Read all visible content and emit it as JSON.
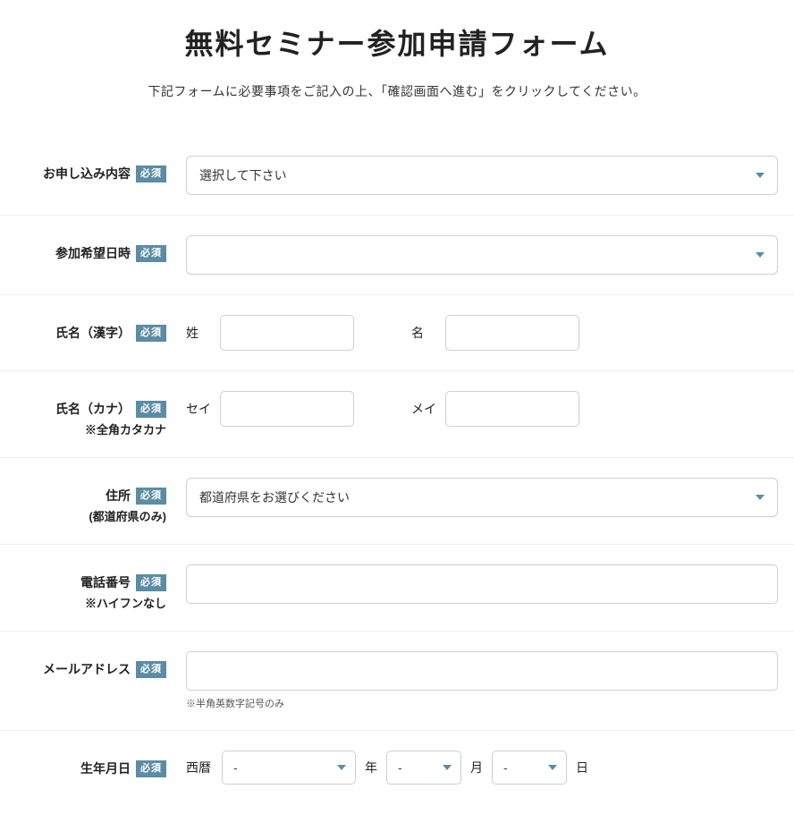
{
  "title": "無料セミナー参加申請フォーム",
  "instruction": "下記フォームに必要事項をご記入の上、「確認画面へ進む」をクリックしてください。",
  "required_badge": "必須",
  "fields": {
    "application": {
      "label": "お申し込み内容",
      "placeholder": "選択して下さい"
    },
    "preferred_date": {
      "label": "参加希望日時",
      "placeholder": ""
    },
    "name_kanji": {
      "label": "氏名（漢字）",
      "last_prefix": "姓",
      "first_prefix": "名"
    },
    "name_kana": {
      "label": "氏名（カナ）",
      "sublabel": "※全角カタカナ",
      "last_prefix": "セイ",
      "first_prefix": "メイ"
    },
    "address": {
      "label": "住所",
      "sublabel": "(都道府県のみ)",
      "placeholder": "都道府県をお選びください"
    },
    "phone": {
      "label": "電話番号",
      "sublabel": "※ハイフンなし"
    },
    "email": {
      "label": "メールアドレス",
      "hint": "※半角英数字記号のみ"
    },
    "birthdate": {
      "label": "生年月日",
      "era": "西暦",
      "year_value": "-",
      "year_unit": "年",
      "month_value": "-",
      "month_unit": "月",
      "day_value": "-",
      "day_unit": "日"
    }
  }
}
